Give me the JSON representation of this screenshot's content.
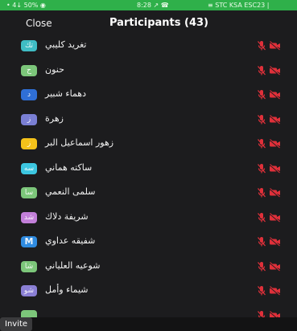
{
  "status_bar": {
    "left": "• 4↓ 50% ◉",
    "time": "‪8:28‬ ↗ ☎",
    "right": "≡ STC KSA ESC23 |"
  },
  "header": {
    "close_label": "Close",
    "title": "Participants (43)"
  },
  "colors": {
    "status_green": "#2fb04a",
    "muted_red": "#e0303a",
    "background": "#1c1c1e"
  },
  "participants": [
    {
      "name": "تغريد كليبي",
      "initials": "تك",
      "avatar_color": "#3fbcc4",
      "mic": "muted-mic-icon",
      "video": "video-off-icon"
    },
    {
      "name": "حنون",
      "initials": "ح",
      "avatar_color": "#7cc67a",
      "mic": "muted-mic-icon",
      "video": "video-off-icon"
    },
    {
      "name": "دهماء شبير",
      "initials": "د",
      "avatar_color": "#2f6fd6",
      "mic": "muted-mic-icon",
      "video": "video-off-icon"
    },
    {
      "name": "زهرة",
      "initials": "ز",
      "avatar_color": "#7a7fd4",
      "mic": "muted-mic-icon",
      "video": "video-off-icon"
    },
    {
      "name": "زهور اسماعيل البر",
      "initials": "ز",
      "avatar_color": "#f4c21a",
      "mic": "muted-mic-icon",
      "video": "video-off-icon"
    },
    {
      "name": "ساكته هماني",
      "initials": "سه",
      "avatar_color": "#3cc6e0",
      "mic": "muted-mic-icon",
      "video": "video-off-icon"
    },
    {
      "name": "سلمى النعمي",
      "initials": "سا",
      "avatar_color": "#7cc67a",
      "mic": "muted-mic-icon",
      "video": "video-off-icon"
    },
    {
      "name": "شريفة دلاك",
      "initials": "شد",
      "avatar_color": "#c27fd9",
      "mic": "muted-mic-icon",
      "video": "video-off-icon"
    },
    {
      "name": "شفيقه عداوي",
      "initials": "M",
      "avatar_color": "#2f8be0",
      "mic": "muted-mic-icon",
      "video": "video-off-icon"
    },
    {
      "name": "شوعيه العلياني",
      "initials": "شا",
      "avatar_color": "#7cc67a",
      "mic": "muted-mic-icon",
      "video": "video-off-icon"
    },
    {
      "name": "شيماء وأمل",
      "initials": "شو",
      "avatar_color": "#8a7fd4",
      "mic": "muted-mic-icon",
      "video": "video-off-icon"
    },
    {
      "name": "",
      "initials": "",
      "avatar_color": "#7cc67a",
      "mic": "muted-mic-icon",
      "video": "video-off-icon"
    }
  ],
  "footer": {
    "invite_label": "Invite"
  }
}
